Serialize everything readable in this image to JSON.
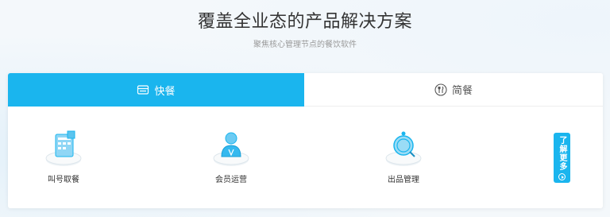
{
  "header": {
    "title": "覆盖全业态的产品解决方案",
    "subtitle": "聚焦核心管理节点的餐饮软件"
  },
  "tabs": [
    {
      "label": "快餐",
      "icon": "tray-icon",
      "active": true
    },
    {
      "label": "简餐",
      "icon": "fork-knife-icon",
      "active": false
    }
  ],
  "features": [
    {
      "label": "叫号取餐",
      "icon": "order-board-icon"
    },
    {
      "label": "会员运营",
      "icon": "member-icon"
    },
    {
      "label": "出品管理",
      "icon": "cloche-icon"
    }
  ],
  "more": {
    "label": "了解更多"
  },
  "colors": {
    "accent": "#1ab5ee",
    "title": "#333333",
    "subtitle": "#9a9a9a"
  }
}
